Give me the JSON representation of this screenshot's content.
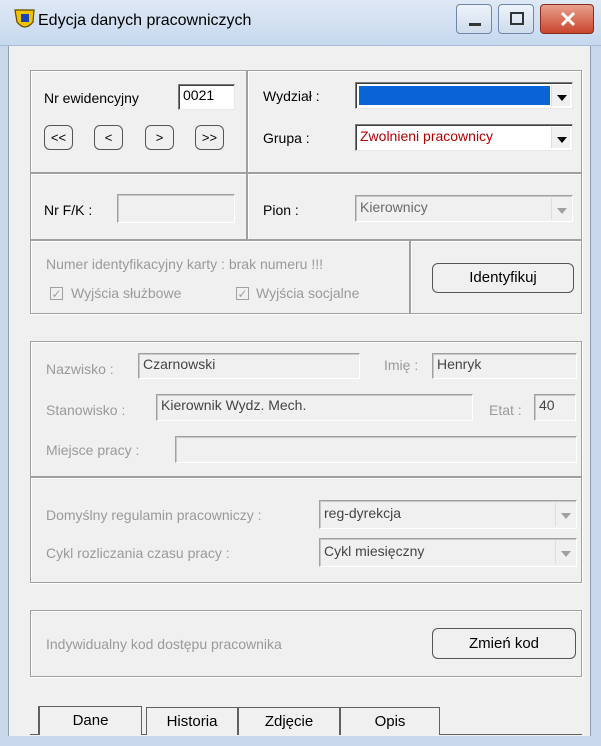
{
  "window": {
    "title": "Edycja danych pracowniczych"
  },
  "record": {
    "nr_ewidencyjny_label": "Nr ewidencyjny",
    "nr_ewidencyjny_value": "0021",
    "nav": [
      "<<",
      "<",
      ">",
      ">>"
    ],
    "wydzial_label": "Wydział :",
    "wydzial_value": "",
    "grupa_label": "Grupa :",
    "grupa_value": "Zwolnieni pracownicy",
    "nr_fk_label": "Nr F/K :",
    "nr_fk_value": "",
    "pion_label": "Pion :",
    "pion_value": "Kierownicy"
  },
  "card": {
    "info": "Numer identyfikacyjny karty : brak numeru !!!",
    "chk1_label": "Wyjścia służbowe",
    "chk2_label": "Wyjścia socjalne",
    "identify_label": "Identyfikuj"
  },
  "person": {
    "nazwisko_label": "Nazwisko :",
    "nazwisko_value": "Czarnowski",
    "imie_label": "Imię :",
    "imie_value": "Henryk",
    "stanowisko_label": "Stanowisko :",
    "stanowisko_value": "Kierownik Wydz. Mech.",
    "etat_label": "Etat :",
    "etat_value": "40",
    "miejsce_label": "Miejsce pracy :",
    "miejsce_value": ""
  },
  "rules": {
    "regulamin_label": "Domyślny regulamin pracowniczy :",
    "regulamin_value": "reg-dyrekcja",
    "cykl_label": "Cykl rozliczania czasu pracy :",
    "cykl_value": "Cykl miesięczny"
  },
  "access": {
    "label": "Indywidualny kod dostępu pracownika",
    "button": "Zmień kod"
  },
  "tabs": [
    "Dane",
    "Historia",
    "Zdjęcie",
    "Opis"
  ],
  "colors": {
    "selected_blue": "#0a64d8",
    "grupa_text": "#b00000"
  }
}
